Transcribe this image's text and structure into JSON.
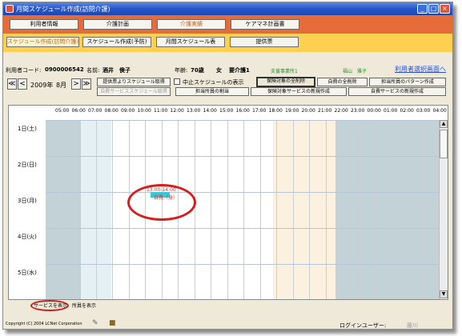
{
  "window": {
    "title": "月間スケジュール作成(訪問介護)",
    "buttons": [
      "_",
      "□",
      "×"
    ]
  },
  "menu": {
    "row1": [
      "利用者情報",
      "介護計画",
      "介護実績",
      "ケアマネ計画書"
    ],
    "row1_active": "介護実績",
    "row2": [
      "スケジュール作成(訪問介護)",
      "スケジュール作成(予防)",
      "月間スケジュール表",
      "提供票"
    ],
    "row2_selected": "スケジュール作成(訪問介護)"
  },
  "info": {
    "user_code_label": "利用者コード:",
    "user_code": "0900006542",
    "name_label": "名前:",
    "name": "酒井　倹子",
    "age_label": "年齢:",
    "age": "70歳",
    "gender": "女",
    "care_level": "要介護1",
    "office": "支援事業所1",
    "manager": "福山　雅子",
    "select_link": "利用者選択画面へ"
  },
  "controls": {
    "prev_prev": "≪",
    "prev": "<",
    "year": "2009年",
    "month": "8月",
    "next": ">",
    "next_next": "≫",
    "get_from_sheet": "提供票よりスケジュール取得",
    "get_self_pay": "自費サービススケジュール取得",
    "show_cancelled": "中止スケジュールの表示",
    "delete_insured": "保険対象の全削除",
    "delete_self_pay": "自費の全削除",
    "staff_pattern": "担当所員のパターン作成",
    "staff_assign": "担当所員の割当",
    "new_insured_service": "保険対象サービスの新規作成",
    "new_self_pay_service": "自費サービスの新規作成"
  },
  "schedule": {
    "hours": [
      "05:00",
      "06:00",
      "07:00",
      "08:00",
      "09:00",
      "10:00",
      "11:00",
      "12:00",
      "13:00",
      "14:00",
      "15:00",
      "16:00",
      "17:00",
      "18:00",
      "19:00",
      "20:00",
      "21:00",
      "22:00",
      "23:00",
      "00:00",
      "01:00",
      "02:00",
      "03:00",
      "04:00"
    ],
    "days": [
      "1日(土)",
      "2日(日)",
      "3日(月)",
      "4日(火)",
      "5日(水)"
    ],
    "event_time": "13:00-14:00",
    "event_label": "自費（身）",
    "scroll_up": "▲",
    "scroll_down": "▼"
  },
  "bottom": {
    "show_service": "サービスを表示",
    "show_staff": "所員を表示"
  },
  "status": {
    "copyright": "Copyright (C) 2004 LCNet Corporation",
    "login_label": "ログインユーザー:",
    "login_user": "藤川"
  },
  "colors": {
    "titlebar": "#2556c8",
    "menu_band": "#e56c38",
    "submenu_band": "#ffd050",
    "night_band": "#c3d2d6",
    "morning_band": "#e5f0f5",
    "evening_band": "#fbf1de",
    "event": "#38c8d8",
    "highlight_circle": "#d61e1e"
  }
}
